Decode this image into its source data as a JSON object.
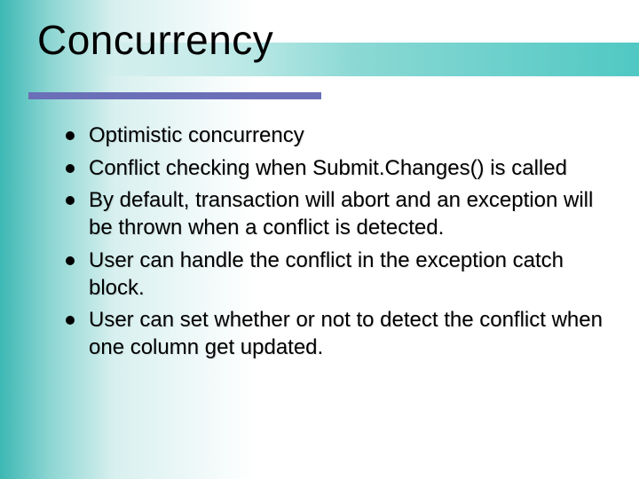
{
  "slide": {
    "title": "Concurrency",
    "bullets": [
      "Optimistic concurrency",
      "Conflict checking when Submit.Changes() is called",
      "By default, transaction will abort and an exception will be thrown when a conflict is detected.",
      "User can handle the conflict in the exception catch block.",
      "User can set whether or not to detect the conflict when one column get updated."
    ]
  }
}
